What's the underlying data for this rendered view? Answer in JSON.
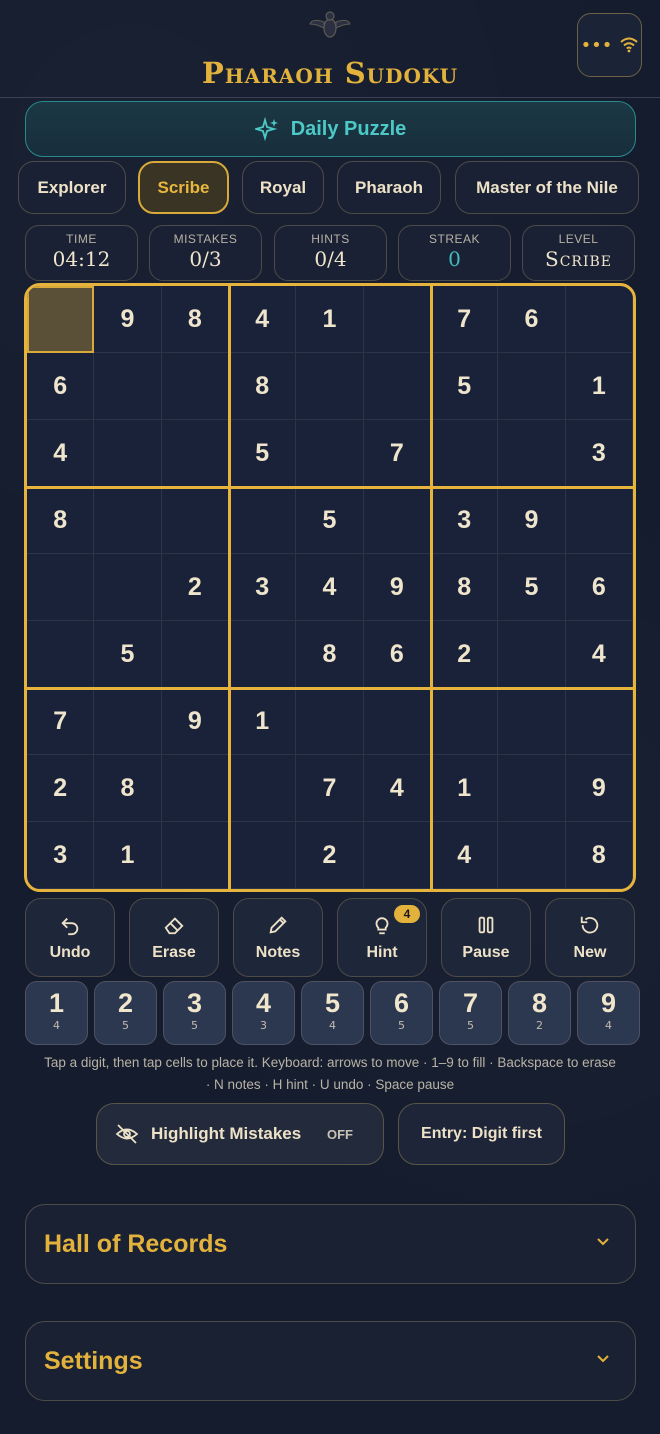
{
  "app": {
    "title": "Pharaoh Sudoku"
  },
  "header": {
    "menu_icon": "more-dots-icon",
    "status_icon": "wifi-icon"
  },
  "daily": {
    "label": "Daily Puzzle"
  },
  "levels": [
    {
      "label": "Explorer",
      "active": false
    },
    {
      "label": "Scribe",
      "active": true
    },
    {
      "label": "Royal",
      "active": false
    },
    {
      "label": "Pharaoh",
      "active": false
    },
    {
      "label": "Master of the Nile",
      "active": false
    }
  ],
  "stats": [
    {
      "label": "TIME",
      "value": "04:12"
    },
    {
      "label": "MISTAKES",
      "value": "0/3"
    },
    {
      "label": "HINTS",
      "value": "0/4"
    },
    {
      "label": "STREAK",
      "value": "0"
    },
    {
      "label": "LEVEL",
      "value": "Scribe"
    }
  ],
  "board": {
    "selected": [
      0,
      0
    ],
    "rows": [
      [
        "",
        "9",
        "8",
        "4",
        "1",
        "",
        "7",
        "6",
        ""
      ],
      [
        "6",
        "",
        "",
        "8",
        "",
        "",
        "5",
        "",
        "1"
      ],
      [
        "4",
        "",
        "",
        "5",
        "",
        "7",
        "",
        "",
        "3"
      ],
      [
        "8",
        "",
        "",
        "",
        "5",
        "",
        "3",
        "9",
        ""
      ],
      [
        "",
        "",
        "2",
        "3",
        "4",
        "9",
        "8",
        "5",
        "6"
      ],
      [
        "",
        "5",
        "",
        "",
        "8",
        "6",
        "2",
        "",
        "4"
      ],
      [
        "7",
        "",
        "9",
        "1",
        "",
        "",
        "",
        "",
        ""
      ],
      [
        "2",
        "8",
        "",
        "",
        "7",
        "4",
        "1",
        "",
        "9"
      ],
      [
        "3",
        "1",
        "",
        "",
        "2",
        "",
        "4",
        "",
        "8"
      ]
    ]
  },
  "actions": [
    {
      "label": "Undo",
      "icon": "undo-icon"
    },
    {
      "label": "Erase",
      "icon": "eraser-icon"
    },
    {
      "label": "Notes",
      "icon": "pencil-icon"
    },
    {
      "label": "Hint",
      "icon": "lightbulb-icon",
      "badge": "4"
    },
    {
      "label": "Pause",
      "icon": "pause-icon"
    },
    {
      "label": "New",
      "icon": "refresh-icon"
    }
  ],
  "digits": [
    {
      "digit": "1",
      "count": "4"
    },
    {
      "digit": "2",
      "count": "5"
    },
    {
      "digit": "3",
      "count": "5"
    },
    {
      "digit": "4",
      "count": "3"
    },
    {
      "digit": "5",
      "count": "4"
    },
    {
      "digit": "6",
      "count": "5"
    },
    {
      "digit": "7",
      "count": "5"
    },
    {
      "digit": "8",
      "count": "2"
    },
    {
      "digit": "9",
      "count": "4"
    }
  ],
  "help": {
    "line1": "Tap a digit, then tap cells to place it. Keyboard: arrows to move · 1–9 to fill · Backspace to erase",
    "line2": "· N notes · H hint · U undo · Space pause"
  },
  "toggles": {
    "highlight_label": "Highlight Mistakes",
    "highlight_state": "OFF",
    "entry_label": "Entry: Digit first"
  },
  "panels": {
    "records": "Hall of Records",
    "settings": "Settings"
  },
  "colors": {
    "gold": "#e3b23c",
    "teal": "#4cc9c7",
    "background": "#141c2e"
  }
}
